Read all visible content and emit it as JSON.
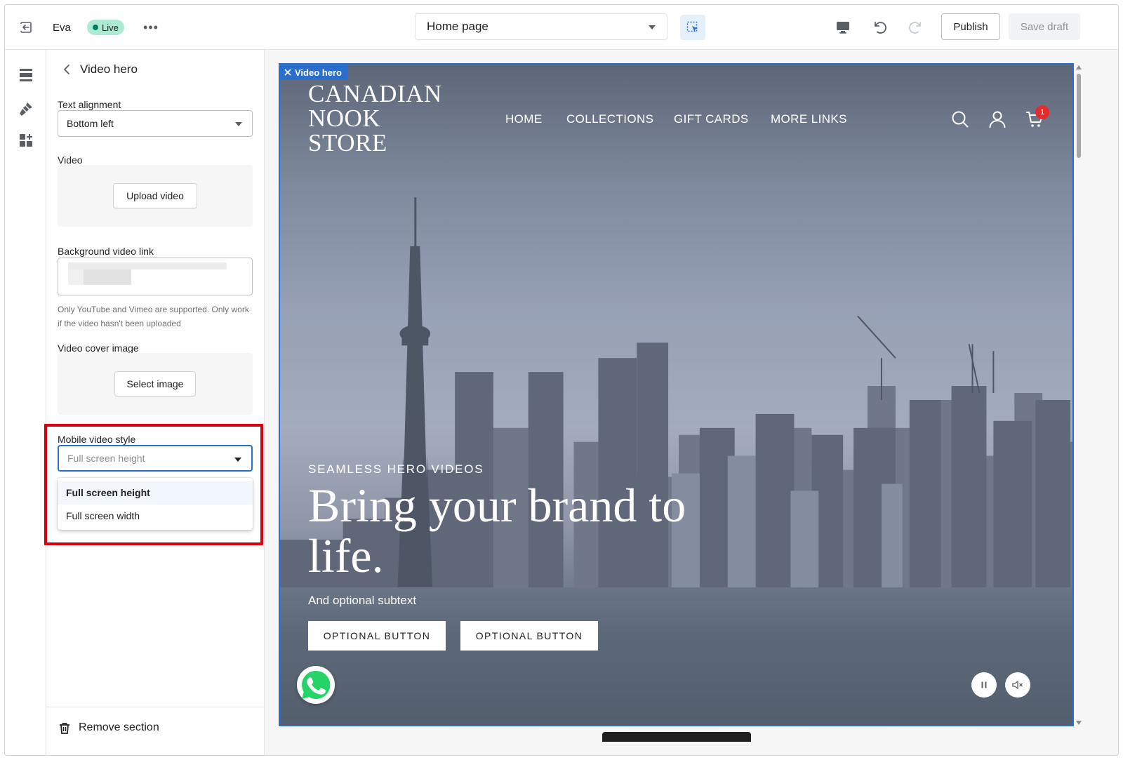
{
  "topbar": {
    "store_name": "Eva",
    "status_badge": "Live",
    "page_selector": "Home page",
    "publish_label": "Publish",
    "save_draft_label": "Save draft"
  },
  "rail": {
    "icons": [
      "sections-icon",
      "theme-settings-icon",
      "apps-icon"
    ]
  },
  "panel": {
    "title": "Video hero",
    "text_alignment": {
      "label": "Text alignment",
      "value": "Bottom left"
    },
    "video": {
      "label": "Video",
      "upload_button": "Upload video"
    },
    "background_video_link": {
      "label": "Background video link",
      "help": "Only YouTube and Vimeo are supported. Only work if the video hasn't been uploaded"
    },
    "video_cover_image": {
      "label": "Video cover image",
      "select_button": "Select image"
    },
    "mobile_video_style": {
      "label": "Mobile video style",
      "placeholder": "Full screen height",
      "options": [
        "Full screen height",
        "Full screen width"
      ],
      "selected_index": 0
    },
    "remove_section_label": "Remove section"
  },
  "preview": {
    "section_tag": "Video hero",
    "logo_lines": [
      "CANADIAN",
      "NOOK",
      "STORE"
    ],
    "nav": [
      "HOME",
      "COLLECTIONS",
      "GIFT CARDS",
      "MORE LINKS"
    ],
    "cart_count": "1",
    "eyebrow": "SEAMLESS HERO VIDEOS",
    "headline": "Bring your brand to life.",
    "subtext": "And optional subtext",
    "buttons": [
      "OPTIONAL BUTTON",
      "OPTIONAL BUTTON"
    ]
  },
  "colors": {
    "accent": "#2c6ecb",
    "live_badge": "#aee9d1",
    "highlight_box": "#d6000f",
    "cart_badge": "#e32c2b"
  }
}
